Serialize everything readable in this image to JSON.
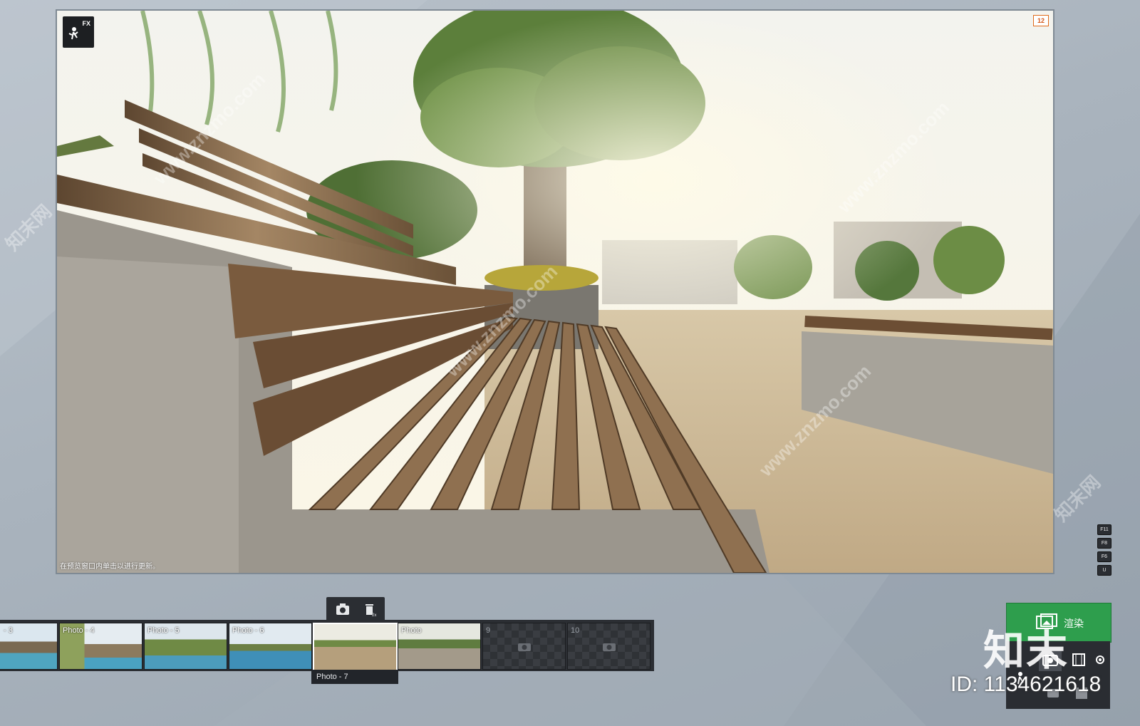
{
  "viewport": {
    "frame_counter": "12",
    "fx_label": "FX",
    "hint": "在预览窗口内单击以进行更新。"
  },
  "watermark": {
    "text": "www.znzmo.com",
    "text_cn": "知末网"
  },
  "hotkeys": [
    "F11",
    "F8",
    "F6",
    "U"
  ],
  "filmstrip": {
    "thumbs": [
      {
        "label": "- 3",
        "state": "photo"
      },
      {
        "label": "Photo - 4",
        "state": "photo"
      },
      {
        "label": "Photo - 5",
        "state": "photo"
      },
      {
        "label": "Photo - 6",
        "state": "photo"
      },
      {
        "label": "",
        "state": "selected"
      },
      {
        "label": "Photo",
        "state": "photo"
      },
      {
        "label": "9",
        "state": "empty"
      },
      {
        "label": "10",
        "state": "empty"
      }
    ],
    "selected_caption": "Photo - 7",
    "tool_icons": [
      "camera-icon",
      "trash-icon"
    ]
  },
  "render": {
    "label": "渲染"
  },
  "overlay": {
    "brand": "知末",
    "id": "ID: 1134621618"
  },
  "colors": {
    "render_green": "#2e9e4d",
    "panel_dark": "#2b2e33",
    "counter_orange": "#e06a1a"
  }
}
